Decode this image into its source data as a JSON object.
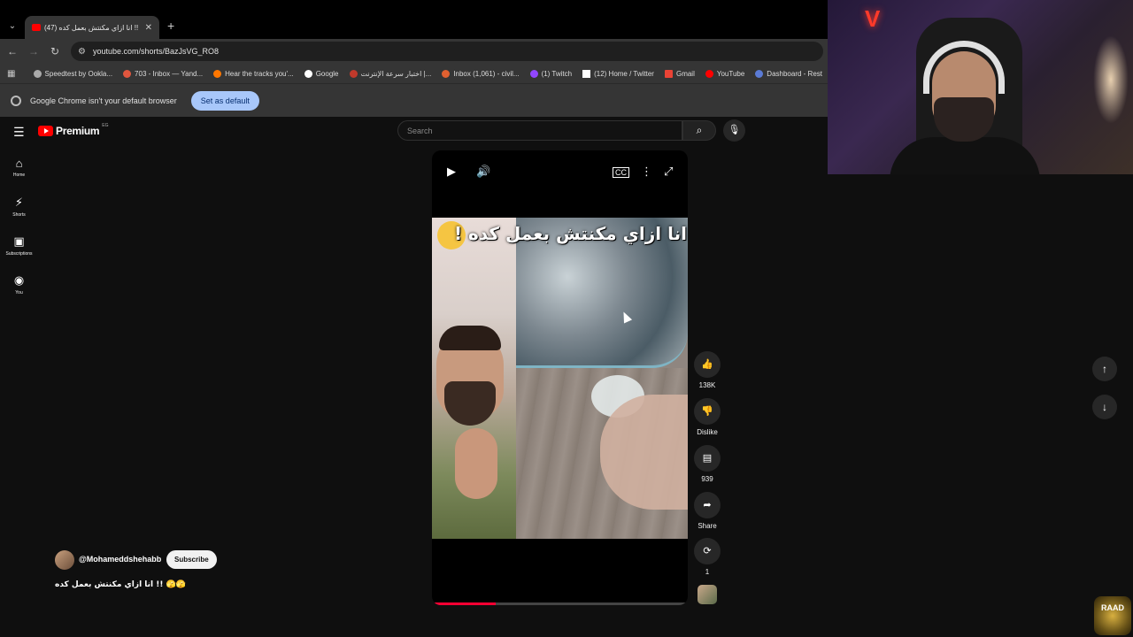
{
  "browser": {
    "tab_title": "(47) انا ازاي مكنتش بعمل كده !!",
    "url": "youtube.com/shorts/BazJsVG_RO8",
    "bookmarks": [
      "Speedtest by Ookla...",
      "703 - Inbox — Yand...",
      "Hear the tracks you'...",
      "Google",
      "اختبار سرعة الإنترنت |...",
      "Inbox (1,061) - civil...",
      "(1) Twitch",
      "(12) Home / Twitter",
      "Gmail",
      "YouTube",
      "Dashboard - Rest"
    ],
    "infobar_message": "Google Chrome isn't your default browser",
    "set_default_label": "Set as default"
  },
  "youtube": {
    "logo_text": "Premium",
    "region": "EG",
    "search_placeholder": "Search",
    "guide": [
      {
        "label": "Home"
      },
      {
        "label": "Shorts"
      },
      {
        "label": "Subscriptions"
      },
      {
        "label": "You"
      }
    ],
    "video": {
      "caption": "انا ازاي مكنتش بعمل كده !",
      "progress": 0.25
    },
    "actions": {
      "likes": "138K",
      "dislike_label": "Dislike",
      "comments": "939",
      "share_label": "Share",
      "remix_count": "1"
    },
    "channel": {
      "handle": "@Mohameddshehabb",
      "subscribe_label": "Subscribe"
    },
    "short_title": "انا ازاي مكنتش بعمل كده !! 🫣🫣"
  },
  "overlay": {
    "badge_text": "RAAD"
  },
  "colors": {
    "accent_red": "#ff0000",
    "progress_red": "#ff0033",
    "set_default_bg": "#a8c7fa"
  }
}
